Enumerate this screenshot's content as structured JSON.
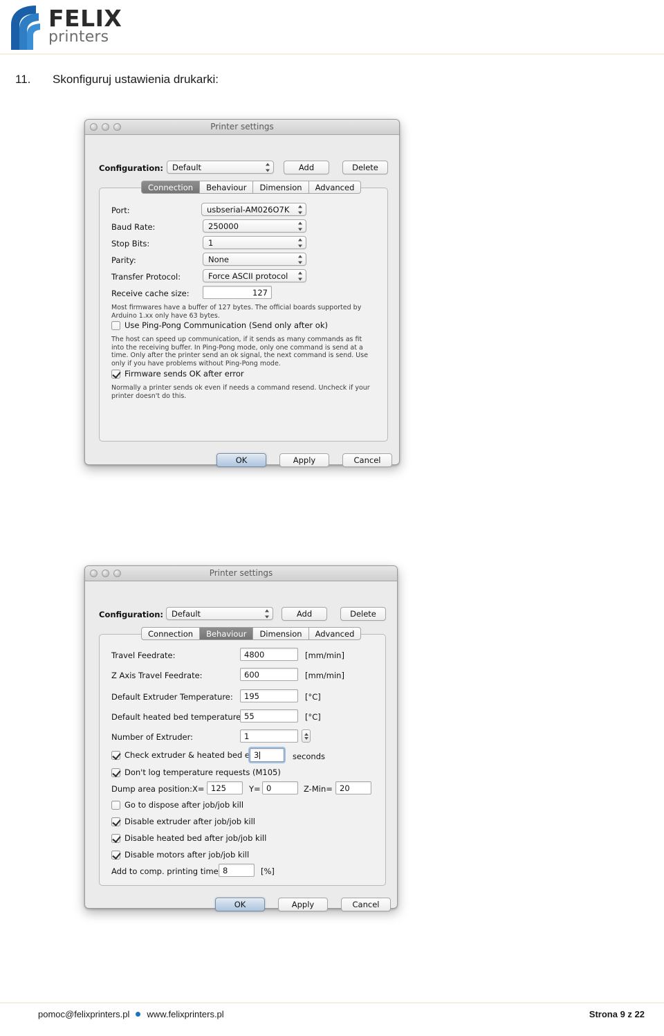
{
  "header": {
    "logo_primary": "FELIX",
    "logo_secondary": "printers",
    "brand_blue_dark": "#1b5fa8",
    "brand_blue_mid": "#2f7dc4",
    "brand_blue_light": "#3c8fd4"
  },
  "step": {
    "number": "11.",
    "text": "Skonfiguruj ustawienia drukarki:"
  },
  "dialog1": {
    "title": "Printer settings",
    "configuration_label": "Configuration:",
    "configuration_value": "Default",
    "add_label": "Add",
    "delete_label": "Delete",
    "tabs": [
      {
        "label": "Connection",
        "active": true
      },
      {
        "label": "Behaviour",
        "active": false
      },
      {
        "label": "Dimension",
        "active": false
      },
      {
        "label": "Advanced",
        "active": false
      }
    ],
    "rows": [
      {
        "label": "Port:",
        "value": "usbserial-AM026O7K"
      },
      {
        "label": "Baud Rate:",
        "value": "250000"
      },
      {
        "label": "Stop Bits:",
        "value": "1"
      },
      {
        "label": "Parity:",
        "value": "None"
      },
      {
        "label": "Transfer Protocol:",
        "value": "Force ASCII protocol"
      }
    ],
    "cache_label": "Receive cache size:",
    "cache_value": "127",
    "cache_help": "Most firmwares have a buffer of 127 bytes. The official boards supported by Arduino 1.xx only have 63 bytes.",
    "pingpong_label": "Use Ping-Pong Communication (Send only after ok)",
    "pingpong_checked": false,
    "pingpong_help": "The host can speed up communication, if it sends as many commands as fit into the receiving buffer. In Ping-Pong mode, only one command is send at a time. Only after the printer send an ok signal, the next command is send. Use only if you have problems without Ping-Pong mode.",
    "firmware_label": "Firmware sends OK after error",
    "firmware_checked": true,
    "firmware_help": "Normally a printer sends ok even if needs a command resend. Uncheck if your printer doesn't do this.",
    "buttons": {
      "ok": "OK",
      "apply": "Apply",
      "cancel": "Cancel"
    }
  },
  "dialog2": {
    "title": "Printer settings",
    "configuration_label": "Configuration:",
    "configuration_value": "Default",
    "add_label": "Add",
    "delete_label": "Delete",
    "tabs": [
      {
        "label": "Connection",
        "active": false
      },
      {
        "label": "Behaviour",
        "active": true
      },
      {
        "label": "Dimension",
        "active": false
      },
      {
        "label": "Advanced",
        "active": false
      }
    ],
    "fields": [
      {
        "label": "Travel Feedrate:",
        "value": "4800",
        "unit": "[mm/min]"
      },
      {
        "label": "Z Axis Travel Feedrate:",
        "value": "600",
        "unit": "[mm/min]"
      },
      {
        "label": "Default Extruder Temperature:",
        "value": "195",
        "unit": "[°C]"
      },
      {
        "label": "Default heated bed temperature:",
        "value": "55",
        "unit": "[°C]"
      },
      {
        "label": "Number of Extruder:",
        "value": "1",
        "unit": ""
      }
    ],
    "check_every_label": "Check extruder & heated bed every",
    "check_every_value": "3",
    "check_every_unit": "seconds",
    "check_every_checked": true,
    "dont_log_label": "Don't log temperature requests (M105)",
    "dont_log_checked": true,
    "dump_area_label": "Dump area position:",
    "dump_x_label": "X=",
    "dump_x_value": "125",
    "dump_y_label": "Y=",
    "dump_y_value": "0",
    "dump_zmin_label": "Z-Min=",
    "dump_zmin_value": "20",
    "checkboxes": [
      {
        "label": "Go to dispose after job/job kill",
        "checked": false
      },
      {
        "label": "Disable extruder after job/job kill",
        "checked": true
      },
      {
        "label": "Disable heated bed after job/job kill",
        "checked": true
      },
      {
        "label": "Disable motors after job/job kill",
        "checked": true
      }
    ],
    "add_time_label": "Add to comp. printing time:",
    "add_time_value": "8",
    "add_time_unit": "[%]",
    "buttons": {
      "ok": "OK",
      "apply": "Apply",
      "cancel": "Cancel"
    }
  },
  "footer": {
    "email": "pomoc@felixprinters.pl",
    "website": "www.felixprinters.pl",
    "page": "Strona 9 z 22"
  }
}
